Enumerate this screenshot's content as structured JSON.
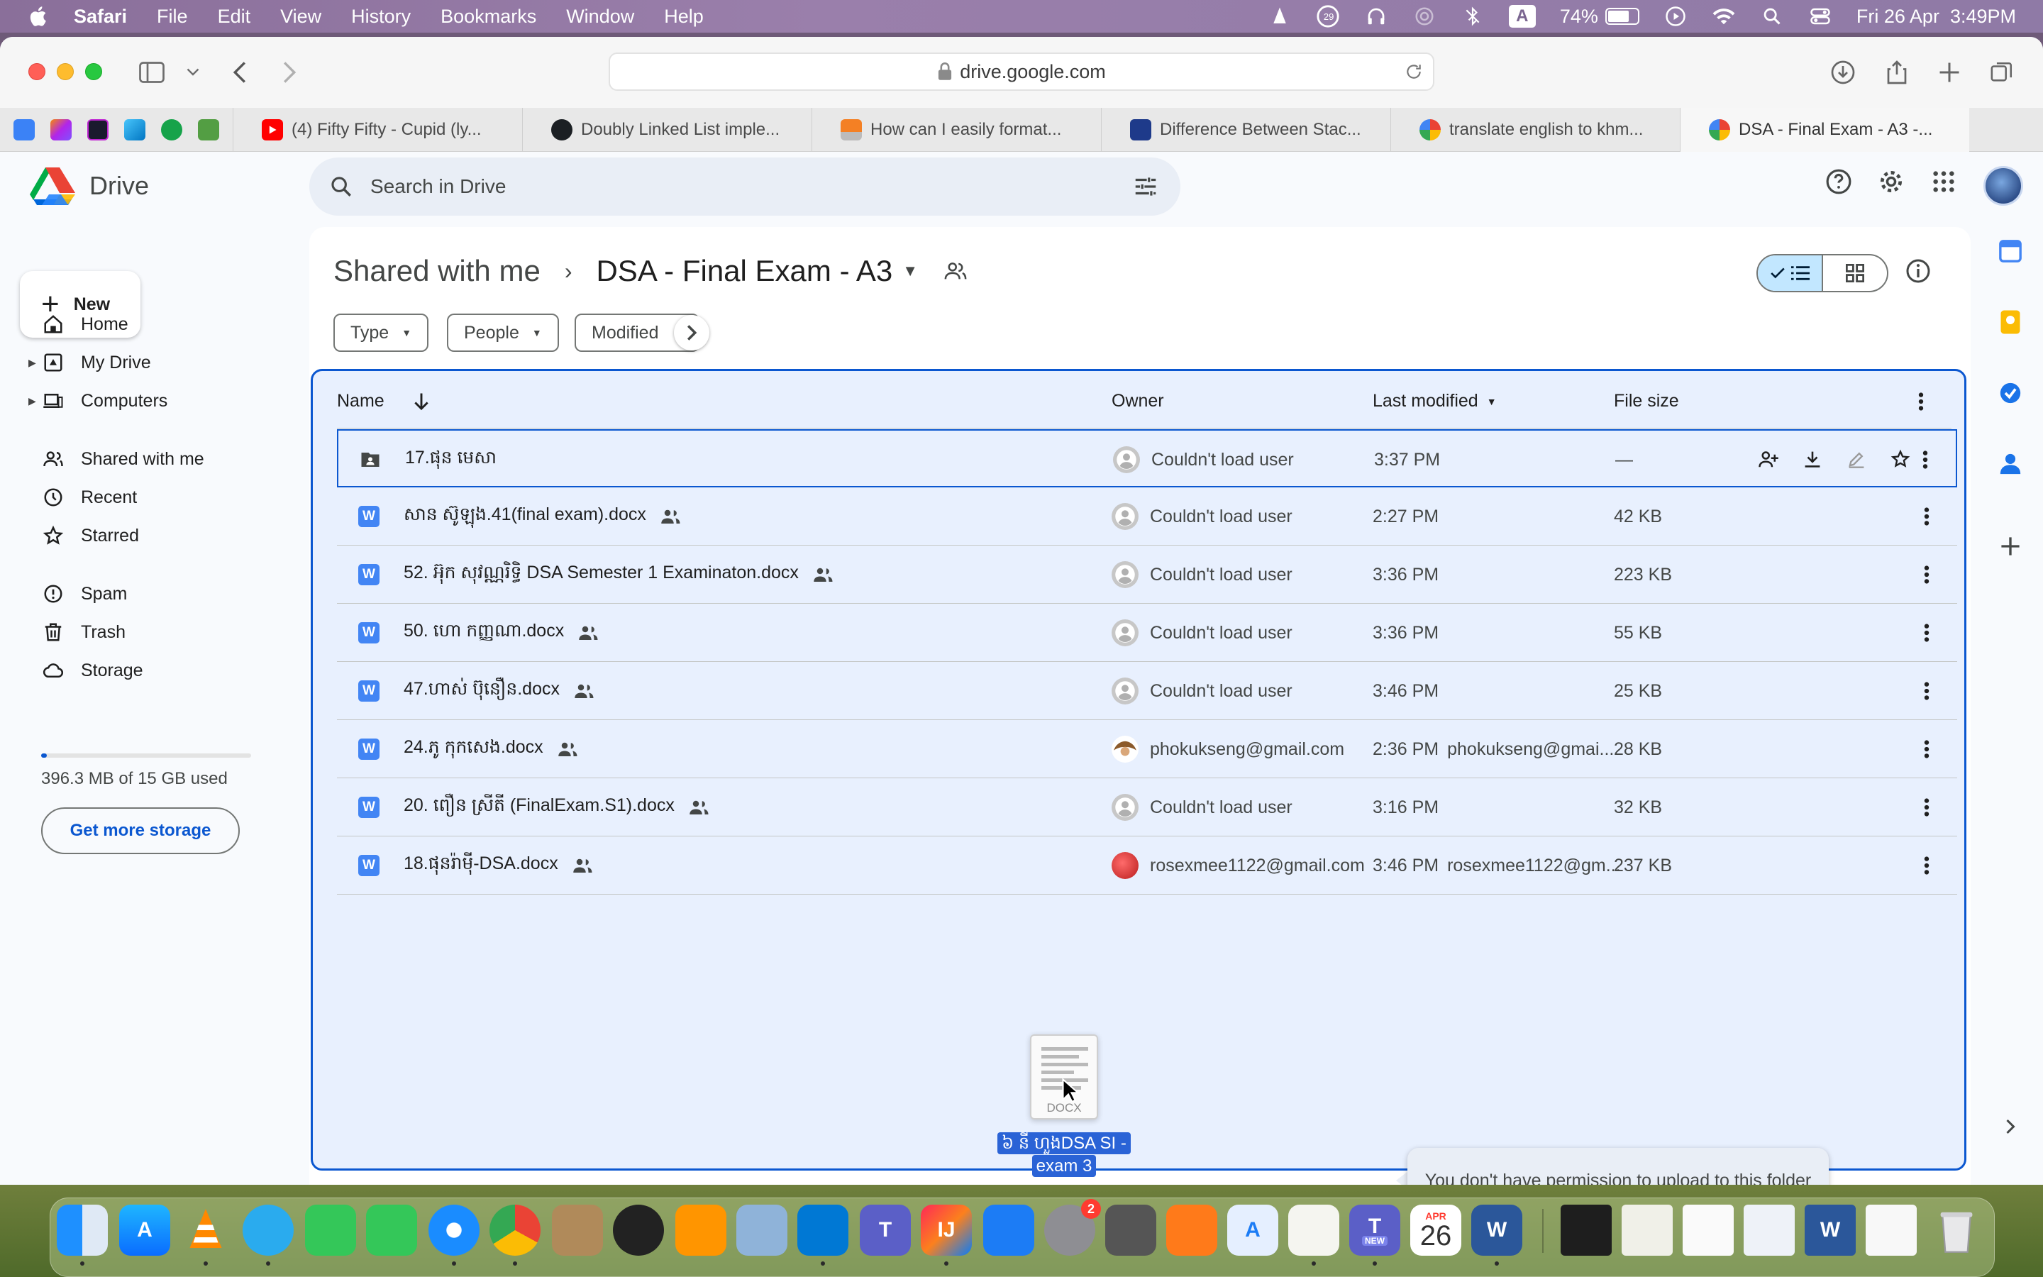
{
  "menubar": {
    "app_name": "Safari",
    "items": [
      "File",
      "Edit",
      "View",
      "History",
      "Bookmarks",
      "Window",
      "Help"
    ],
    "keyboard_label": "A",
    "battery_percent": 74,
    "battery_label": "74%",
    "datetime": "Fri 26 Apr  3:49PM",
    "notification_count": "29"
  },
  "browser": {
    "url": "drive.google.com",
    "tabs": [
      {
        "label": "(4) Fifty Fifty - Cupid (ly...",
        "icon": "youtube-icon"
      },
      {
        "label": "Doubly Linked List imple...",
        "icon": "github-icon"
      },
      {
        "label": "How can I easily format...",
        "icon": "stackoverflow-icon"
      },
      {
        "label": "Difference Between Stac...",
        "icon": "bookmark-icon"
      },
      {
        "label": "translate english to khm...",
        "icon": "google-icon"
      },
      {
        "label": "DSA - Final Exam - A3 -...",
        "icon": "google-icon"
      }
    ]
  },
  "drive": {
    "brand": "Drive",
    "search_placeholder": "Search in Drive",
    "new_label": "New",
    "nav": [
      {
        "label": "Home",
        "icon": "home-icon",
        "caret": false
      },
      {
        "label": "My Drive",
        "icon": "my-drive-icon",
        "caret": true
      },
      {
        "label": "Computers",
        "icon": "computers-icon",
        "caret": true
      },
      {
        "label": "Shared with me",
        "icon": "shared-with-me-icon",
        "caret": false
      },
      {
        "label": "Recent",
        "icon": "clock-icon",
        "caret": false
      },
      {
        "label": "Starred",
        "icon": "star-icon",
        "caret": false
      },
      {
        "label": "Spam",
        "icon": "spam-icon",
        "caret": false
      },
      {
        "label": "Trash",
        "icon": "trash-icon",
        "caret": false
      },
      {
        "label": "Storage",
        "icon": "cloud-icon",
        "caret": false
      }
    ],
    "storage_text": "396.3 MB of 15 GB used",
    "storage_fraction": 0.026,
    "get_more_storage": "Get more storage",
    "breadcrumb": {
      "parent": "Shared with me",
      "current": "DSA - Final Exam - A3"
    },
    "filters": [
      "Type",
      "People",
      "Modified"
    ],
    "columns": {
      "name": "Name",
      "owner": "Owner",
      "last_modified": "Last modified",
      "file_size": "File size"
    },
    "files": [
      {
        "name": "17.ផុន មេសា",
        "type": "folder",
        "shared": false,
        "owner": "Couldn't load user",
        "avatar": "default",
        "modified": "3:37 PM",
        "modified_by": "",
        "size": "—",
        "selected": true
      },
      {
        "name": "សាន ស៊ូឡុង.41(final exam).docx",
        "type": "docx",
        "shared": true,
        "owner": "Couldn't load user",
        "avatar": "default",
        "modified": "2:27 PM",
        "modified_by": "",
        "size": "42 KB",
        "selected": false
      },
      {
        "name": "52. អ៊ុក សុវណ្ណរិទ្ធិ DSA Semester 1 Examinaton.docx",
        "type": "docx",
        "shared": true,
        "owner": "Couldn't load user",
        "avatar": "default",
        "modified": "3:36 PM",
        "modified_by": "",
        "size": "223 KB",
        "selected": false
      },
      {
        "name": "50. ហោ កញ្ញណា.docx",
        "type": "docx",
        "shared": true,
        "owner": "Couldn't load user",
        "avatar": "default",
        "modified": "3:36 PM",
        "modified_by": "",
        "size": "55 KB",
        "selected": false
      },
      {
        "name": "47.ហាស់ ប៊ុនឿន.docx",
        "type": "docx",
        "shared": true,
        "owner": "Couldn't load user",
        "avatar": "default",
        "modified": "3:46 PM",
        "modified_by": "",
        "size": "25 KB",
        "selected": false
      },
      {
        "name": "24.ភូ កុកសេង.docx",
        "type": "docx",
        "shared": true,
        "owner": "phokukseng@gmail.com",
        "avatar": "photo",
        "modified": "2:36 PM",
        "modified_by": "phokukseng@gmai...",
        "size": "28 KB",
        "selected": false
      },
      {
        "name": "20. ពឿន ស្រីតី (FinalExam.S1).docx",
        "type": "docx",
        "shared": true,
        "owner": "Couldn't load user",
        "avatar": "default",
        "modified": "3:16 PM",
        "modified_by": "",
        "size": "32 KB",
        "selected": false
      },
      {
        "name": "18.ផុនរ៉ាម៉ី-DSA.docx",
        "type": "docx",
        "shared": true,
        "owner": "rosexmee1122@gmail.com",
        "avatar": "photo-red",
        "modified": "3:46 PM",
        "modified_by": "rosexmee1122@gm...",
        "size": "237 KB",
        "selected": false
      }
    ],
    "drag": {
      "file_ext": "DOCX",
      "file_label_line1": "៦ នី ហួងDSA SI -",
      "file_label_line2": "exam 3",
      "message": "You don't have permission to upload to this folder"
    }
  },
  "dock": {
    "calendar_month": "APR",
    "calendar_day": "26",
    "settings_badge": "2",
    "teams_new": "NEW"
  },
  "colors": {
    "accent": "#0b57d0",
    "selected_bg": "#e8f0fe",
    "chip_active": "#c2e7ff"
  }
}
